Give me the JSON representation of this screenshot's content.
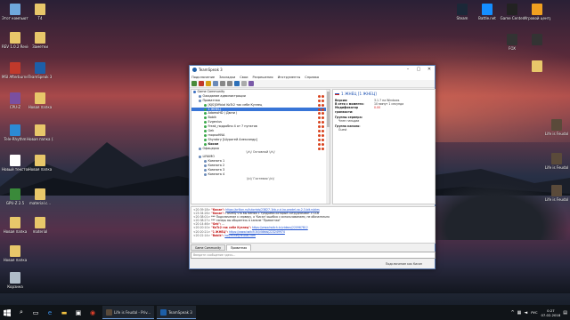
{
  "desktop": {
    "icons_left": [
      {
        "label": "Этот компьютер",
        "color": "#6fa8dc"
      },
      {
        "label": "T4",
        "color": "#e8c76a"
      },
      {
        "label": "REV 1.0.2 Revision",
        "color": "#e8c76a"
      },
      {
        "label": "Заметки",
        "color": "#e8c76a"
      },
      {
        "label": "MSI Afterburner",
        "color": "#c0392b"
      },
      {
        "label": "TeamSpeak 3",
        "color": "#1d5fa8"
      },
      {
        "label": "CPU-Z",
        "color": "#7a4fa0"
      },
      {
        "label": "Новая папка",
        "color": "#e8c76a"
      },
      {
        "label": "Tele-Rhythm",
        "color": "#2c8ad4"
      },
      {
        "label": "Новая папка (2)",
        "color": "#e8c76a"
      },
      {
        "label": "Новый текстовы...",
        "color": "#ffffff"
      },
      {
        "label": "Новая папка",
        "color": "#e8c76a"
      },
      {
        "label": "GPU-Z 2.5",
        "color": "#3a8a3a"
      },
      {
        "label": "material.c...",
        "color": "#e8c76a"
      },
      {
        "label": "Новая папка",
        "color": "#e8c76a"
      },
      {
        "label": "material",
        "color": "#e8c76a"
      },
      {
        "label": "Новая папка",
        "color": "#e8c76a"
      },
      {
        "label": "Корзина",
        "color": "#b0bcc8"
      }
    ],
    "icons_right": [
      {
        "label": "Steam",
        "color": "#1b2838"
      },
      {
        "label": "Battle.net",
        "color": "#148eff"
      },
      {
        "label": "Game Center",
        "color": "#222"
      },
      {
        "label": "Игровой центр",
        "color": "#f0a020"
      },
      {
        "label": "FOX",
        "color": "#333"
      },
      {
        "label": "",
        "color": "#333"
      },
      {
        "label": "",
        "color": "#e8c76a"
      },
      {
        "label": "Life is Feudal",
        "color": "#5a4a3a"
      },
      {
        "label": "Life is Feudal",
        "color": "#5a4a3a"
      },
      {
        "label": "Life is Feudal",
        "color": "#5a4a3a"
      }
    ]
  },
  "window": {
    "title": "TeamSpeak 3",
    "menu": [
      "Подключение",
      "Закладки",
      "Свои",
      "Разрешения",
      "Инструменты",
      "Справка"
    ],
    "tree": [
      {
        "text": "Game Community",
        "kind": "server",
        "indent": 2
      },
      {
        "text": "Ожидание администрации",
        "kind": "channel",
        "indent": 8
      },
      {
        "text": "Приватная",
        "kind": "channel",
        "indent": 8
      },
      {
        "text": "[KJS]Official KoTc2 так себе Кузнец",
        "kind": "user",
        "indent": 14
      },
      {
        "text": "1 ЖНЕЦ",
        "kind": "user",
        "indent": 14,
        "selected": true
      },
      {
        "text": "AdamoHD ( Дюни )",
        "kind": "user",
        "indent": 14
      },
      {
        "text": "Bobik",
        "kind": "user",
        "indent": 14
      },
      {
        "text": "Evgenius",
        "kind": "user",
        "indent": 14
      },
      {
        "text": "Freak_подробно 4 от 7 пунктов",
        "kind": "user",
        "indent": 14
      },
      {
        "text": "Gek",
        "kind": "user",
        "indent": 14
      },
      {
        "text": "mopsoHNA",
        "kind": "user",
        "indent": 14
      },
      {
        "text": "Shyrabry [Шурагей Александр]",
        "kind": "user",
        "indent": 14
      },
      {
        "text": "Кисан",
        "kind": "user",
        "indent": 14,
        "bold": true
      },
      {
        "text": "Офицерка",
        "kind": "channel",
        "indent": 8
      },
      {
        "text": "\\/c\\/ Основной \\/c\\/",
        "kind": "spacer",
        "indent": 0
      },
      {
        "text": "LIFAIMO",
        "kind": "channel",
        "indent": 8
      },
      {
        "text": "Комната 1",
        "kind": "channel",
        "indent": 14
      },
      {
        "text": "Комната 2",
        "kind": "channel",
        "indent": 14
      },
      {
        "text": "Комната 3",
        "kind": "channel",
        "indent": 14
      },
      {
        "text": "Комната 4",
        "kind": "channel",
        "indent": 14
      },
      {
        "text": "\\/c\\/ Гостевая \\/c\\/",
        "kind": "spacer",
        "indent": 0
      }
    ],
    "info": {
      "name": "1 ЖНЕЦ [1 ЖНЕЦ]",
      "rows": [
        {
          "k": "Версия:",
          "v": "3.1.7 на Windows"
        },
        {
          "k": "В сети с момента:",
          "v": "10 минут 1 секунда"
        },
        {
          "k": "Модификатор громкости:",
          "v": "0.00",
          "red": true
        }
      ],
      "server_groups_title": "Группы сервера:",
      "server_groups": [
        "Член гильдии"
      ],
      "channel_group_title": "Группа канала:",
      "channel_group": [
        "Guest"
      ]
    },
    "chat": [
      {
        "time": "<20:39:18>",
        "name": "\"Кисан\":",
        "text": "",
        "link": "https://prilion.ru/tutorials/23827-1kb-v-ci-ko-prodel-vo-2-3-bit-rubles"
      },
      {
        "time": "<23:34:26>",
        "name": "\"Кисан\":",
        "text": "Почему что вы меняю с тундрами которые сотрудничают с GCB",
        "link": ""
      },
      {
        "time": "<20:38:01>",
        "name": "",
        "text": "*** Подключение к серверу, а 'Кисан' ошибка c использованием, не обязательно",
        "link": ""
      },
      {
        "time": "<20:38:27>",
        "name": "",
        "text": "*** теперь вы общаетесь в канале \"Приватная\"",
        "link": ""
      },
      {
        "time": "<20:14:46>",
        "name": "\"Gek\":",
        "text": "...",
        "link": ""
      },
      {
        "time": "<20:20:10>",
        "name": "\"KoTc2 так себе Кузнец\":",
        "text": "",
        "link": "https://www.twitch.tv/videos/220967812"
      },
      {
        "time": "<20:20:21>",
        "name": "\"1 ЖНЕЦ\":",
        "text": "",
        "link": "https://www.twitch.tv/videos/223249974"
      },
      {
        "time": "<20:22:14>",
        "name": "\"Bobik\":",
        "text": "",
        "link": "holymine@feudal.com"
      }
    ],
    "tabs": [
      "Game Community",
      "Приватная"
    ],
    "input_placeholder": "Введите сообщение здесь...",
    "status": "Подключение как Кисан"
  },
  "taskbar": {
    "search_glyph": "⌕",
    "apps": [
      {
        "label": "Life is Feudal - Priv...",
        "color": "#5a4a3a"
      },
      {
        "label": "TeamSpeak 3",
        "color": "#1d5fa8"
      }
    ],
    "tray": {
      "lang": "РУС",
      "time": "0:27",
      "date": "07.02.2018"
    }
  }
}
